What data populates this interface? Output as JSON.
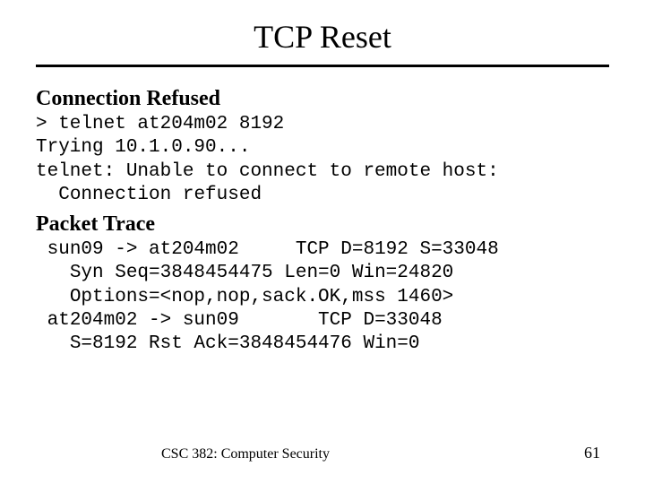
{
  "title": "TCP Reset",
  "section1": {
    "heading": "Connection Refused",
    "code": "> telnet at204m02 8192\nTrying 10.1.0.90...\ntelnet: Unable to connect to remote host:\n  Connection refused"
  },
  "section2": {
    "heading": "Packet Trace",
    "code": " sun09 -> at204m02     TCP D=8192 S=33048\n   Syn Seq=3848454475 Len=0 Win=24820\n   Options=<nop,nop,sack.OK,mss 1460>\n at204m02 -> sun09       TCP D=33048\n   S=8192 Rst Ack=3848454476 Win=0"
  },
  "footer": {
    "course": "CSC 382: Computer Security",
    "page": "61"
  }
}
